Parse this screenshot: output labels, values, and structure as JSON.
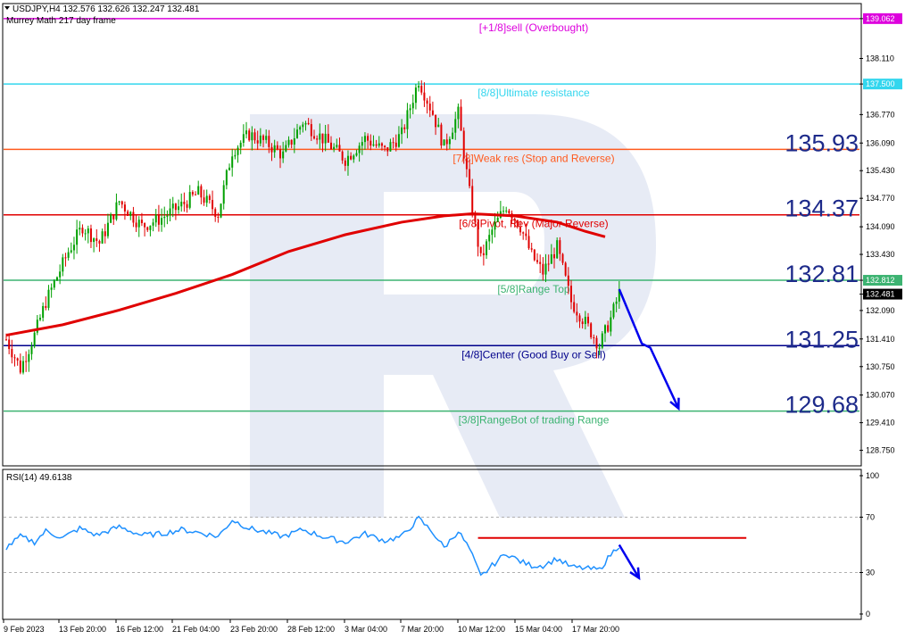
{
  "header": {
    "symbol_line": "USDJPY,H4  132.576 132.626 132.247 132.481",
    "indicator": "Murrey Math 217 day frame"
  },
  "colors": {
    "bull": "#00a000",
    "bear": "#e00000",
    "ma": "#e00000",
    "rsi": "#1e90ff",
    "arrow": "#0000ee",
    "watermark": "#e3e8f3"
  },
  "chart_data": [
    {
      "type": "candlestick",
      "title": "USDJPY,H4",
      "ylim": [
        128.5,
        139.2
      ],
      "y_ticks": [
        "139.062",
        "138.110",
        "137.500",
        "136.770",
        "136.090",
        "135.430",
        "134.770",
        "134.090",
        "133.430",
        "132.812",
        "132.481",
        "132.090",
        "131.410",
        "130.750",
        "130.070",
        "129.410",
        "128.750"
      ],
      "x_ticks": [
        "9 Feb 2023",
        "13 Feb 20:00",
        "16 Feb 12:00",
        "21 Feb 04:00",
        "23 Feb 20:00",
        "28 Feb 12:00",
        "3 Mar 04:00",
        "7 Mar 20:00",
        "10 Mar 12:00",
        "15 Mar 04:00",
        "17 Mar 20:00"
      ],
      "last_price": 132.481,
      "ohlc_path": [
        {
          "x": 0,
          "y": 131.4
        },
        {
          "x": 5,
          "y": 130.7
        },
        {
          "x": 10,
          "y": 131.5
        },
        {
          "x": 14,
          "y": 132.3
        },
        {
          "x": 18,
          "y": 132.9
        },
        {
          "x": 22,
          "y": 133.5
        },
        {
          "x": 27,
          "y": 134.1
        },
        {
          "x": 33,
          "y": 133.7
        },
        {
          "x": 40,
          "y": 134.7
        },
        {
          "x": 48,
          "y": 134.1
        },
        {
          "x": 55,
          "y": 134.3
        },
        {
          "x": 62,
          "y": 134.6
        },
        {
          "x": 68,
          "y": 134.9
        },
        {
          "x": 75,
          "y": 134.4
        },
        {
          "x": 80,
          "y": 135.9
        },
        {
          "x": 86,
          "y": 136.3
        },
        {
          "x": 92,
          "y": 136.1
        },
        {
          "x": 98,
          "y": 135.8
        },
        {
          "x": 105,
          "y": 136.6
        },
        {
          "x": 112,
          "y": 136.2
        },
        {
          "x": 120,
          "y": 135.7
        },
        {
          "x": 127,
          "y": 136.2
        },
        {
          "x": 134,
          "y": 135.9
        },
        {
          "x": 140,
          "y": 136.3
        },
        {
          "x": 146,
          "y": 137.6
        },
        {
          "x": 151,
          "y": 136.8
        },
        {
          "x": 155,
          "y": 136.0
        },
        {
          "x": 160,
          "y": 136.8
        },
        {
          "x": 164,
          "y": 134.9
        },
        {
          "x": 168,
          "y": 133.3
        },
        {
          "x": 172,
          "y": 134.0
        },
        {
          "x": 177,
          "y": 134.6
        },
        {
          "x": 182,
          "y": 134.1
        },
        {
          "x": 186,
          "y": 133.4
        },
        {
          "x": 190,
          "y": 133.0
        },
        {
          "x": 195,
          "y": 133.6
        },
        {
          "x": 200,
          "y": 132.3
        },
        {
          "x": 205,
          "y": 131.8
        },
        {
          "x": 210,
          "y": 131.25
        },
        {
          "x": 214,
          "y": 131.9
        },
        {
          "x": 217,
          "y": 132.5
        }
      ],
      "ma_path": [
        {
          "x": 0,
          "y": 131.5
        },
        {
          "x": 20,
          "y": 131.75
        },
        {
          "x": 40,
          "y": 132.1
        },
        {
          "x": 60,
          "y": 132.5
        },
        {
          "x": 80,
          "y": 132.95
        },
        {
          "x": 100,
          "y": 133.5
        },
        {
          "x": 120,
          "y": 133.9
        },
        {
          "x": 140,
          "y": 134.2
        },
        {
          "x": 155,
          "y": 134.35
        },
        {
          "x": 165,
          "y": 134.4
        },
        {
          "x": 180,
          "y": 134.35
        },
        {
          "x": 195,
          "y": 134.2
        },
        {
          "x": 205,
          "y": 133.98
        },
        {
          "x": 212,
          "y": 133.85
        }
      ],
      "murrey_levels": [
        {
          "label": "[+1/8]sell (Overbought)",
          "value": 139.062,
          "tag": "139.062",
          "color": "#dd00dd"
        },
        {
          "label": "[8/8]Ultimate resistance",
          "value": 137.5,
          "tag": "137.500",
          "color": "#33d6ee"
        },
        {
          "label": "[7/8]Weak res (Stop and Reverse)",
          "value": 135.938,
          "tag": "135.938",
          "color": "#ff5a1e",
          "big": "135.93"
        },
        {
          "label": "[6/8]Pivot, Rev (Major Reverse)",
          "value": 134.375,
          "tag": "134.375",
          "color": "#e00000",
          "big": "134.37"
        },
        {
          "label": "[5/8]Range Top",
          "value": 132.812,
          "tag": "132.812",
          "color": "#3cb371",
          "big": "132.81"
        },
        {
          "label": "[4/8]Center (Good Buy or Sell)",
          "value": 131.25,
          "tag": "131.250",
          "color": "#00008b",
          "big": "131.25"
        },
        {
          "label": "[3/8]RangeBot of trading Range",
          "value": 129.688,
          "tag": "129.688",
          "color": "#3cb371",
          "big": "129.68"
        }
      ],
      "forecast_arrow": [
        {
          "x": 217,
          "y": 132.6
        },
        {
          "x": 225,
          "y": 131.3
        },
        {
          "x": 228,
          "y": 131.2
        },
        {
          "x": 238,
          "y": 129.75
        }
      ]
    },
    {
      "type": "line",
      "title": "RSI(14) 49.6138",
      "ylim": [
        0,
        100
      ],
      "y_ticks": [
        "100",
        "70",
        "30",
        "0"
      ],
      "path": [
        {
          "x": 0,
          "y": 48
        },
        {
          "x": 5,
          "y": 56
        },
        {
          "x": 10,
          "y": 52
        },
        {
          "x": 14,
          "y": 60
        },
        {
          "x": 20,
          "y": 55
        },
        {
          "x": 26,
          "y": 62
        },
        {
          "x": 32,
          "y": 57
        },
        {
          "x": 40,
          "y": 63
        },
        {
          "x": 48,
          "y": 57
        },
        {
          "x": 55,
          "y": 58
        },
        {
          "x": 62,
          "y": 61
        },
        {
          "x": 68,
          "y": 59
        },
        {
          "x": 75,
          "y": 56
        },
        {
          "x": 80,
          "y": 68
        },
        {
          "x": 86,
          "y": 62
        },
        {
          "x": 92,
          "y": 59
        },
        {
          "x": 98,
          "y": 56
        },
        {
          "x": 105,
          "y": 61
        },
        {
          "x": 112,
          "y": 56
        },
        {
          "x": 120,
          "y": 52
        },
        {
          "x": 127,
          "y": 58
        },
        {
          "x": 134,
          "y": 53
        },
        {
          "x": 140,
          "y": 56
        },
        {
          "x": 146,
          "y": 69
        },
        {
          "x": 151,
          "y": 59
        },
        {
          "x": 155,
          "y": 48
        },
        {
          "x": 160,
          "y": 60
        },
        {
          "x": 164,
          "y": 47
        },
        {
          "x": 168,
          "y": 27
        },
        {
          "x": 172,
          "y": 35
        },
        {
          "x": 177,
          "y": 44
        },
        {
          "x": 182,
          "y": 38
        },
        {
          "x": 186,
          "y": 35
        },
        {
          "x": 190,
          "y": 35
        },
        {
          "x": 195,
          "y": 40
        },
        {
          "x": 200,
          "y": 34
        },
        {
          "x": 205,
          "y": 33
        },
        {
          "x": 210,
          "y": 32
        },
        {
          "x": 214,
          "y": 43
        },
        {
          "x": 217,
          "y": 49.6
        }
      ],
      "resistance": {
        "from": 167,
        "to": 262,
        "value": 55
      },
      "forecast_arrow": [
        {
          "x": 217,
          "y": 50
        },
        {
          "x": 224,
          "y": 26
        }
      ]
    }
  ]
}
